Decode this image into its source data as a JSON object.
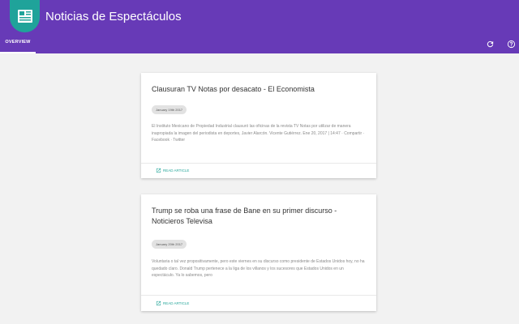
{
  "app": {
    "title": "Noticias de Espectáculos"
  },
  "tabs": [
    {
      "label": "OVERVIEW"
    }
  ],
  "actions": {
    "refresh_icon": "refresh-icon",
    "info_icon": "help-circle-icon"
  },
  "colors": {
    "primary": "#673ab7",
    "accent": "#1fa39a",
    "link": "#26a69a"
  },
  "articles": [
    {
      "title": "Clausuran TV Notas por desacato - El Economista",
      "date": "January 19th 2017",
      "body": "El Instituto Mexicano de Propiedad Industrial clausuró las oficinas de la revista TV Notas por utilizar de manera inapropiada la imagen del periodista en deportes, Javier Alarcón. Vicente Gutiérrez. Ene 20, 2017 | 14:47 · Compartir · Facebook · Twitter",
      "read_label": "READ ARTICLE"
    },
    {
      "title": "Trump se roba una frase de Bane en su primer discurso - Noticieros Televisa",
      "date": "January 20th 2017",
      "body": "Voluntaria o tal vez propositivamente, pero este viernes en su discurso como presidente de Estados Unidos hoy, no ha quedado claro. Donald Trump pertenece a la liga de los villanos y los sucesores que Estados Unidos en un espectáculo. Ya lo sabemos, pero",
      "read_label": "READ ARTICLE"
    }
  ]
}
